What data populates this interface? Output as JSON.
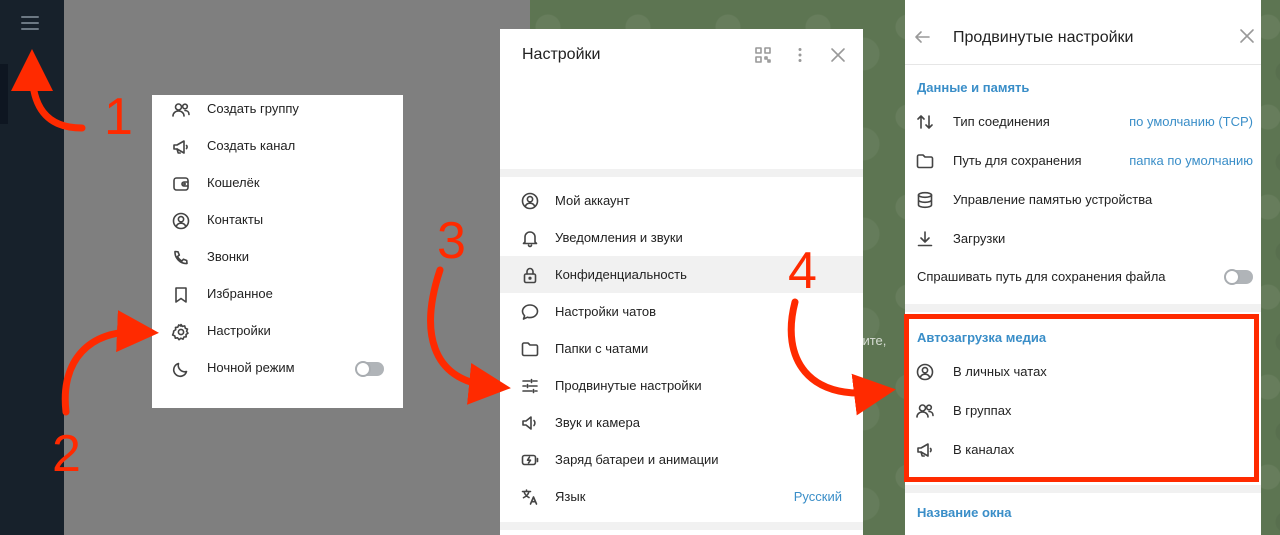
{
  "colors": {
    "accent": "#3a8ec8",
    "annotation": "#ff2a00",
    "sidebar": "#17212b"
  },
  "menu": {
    "items": [
      {
        "label": "Создать группу",
        "icon": "group-icon"
      },
      {
        "label": "Создать канал",
        "icon": "megaphone-icon"
      },
      {
        "label": "Кошелёк",
        "icon": "wallet-icon"
      },
      {
        "label": "Контакты",
        "icon": "contact-icon"
      },
      {
        "label": "Звонки",
        "icon": "phone-icon"
      },
      {
        "label": "Избранное",
        "icon": "bookmark-icon"
      },
      {
        "label": "Настройки",
        "icon": "gear-icon"
      },
      {
        "label": "Ночной режим",
        "icon": "moon-icon"
      }
    ],
    "night_mode_on": false
  },
  "settings": {
    "title": "Настройки",
    "items": [
      {
        "label": "Мой аккаунт",
        "icon": "account-icon"
      },
      {
        "label": "Уведомления и звуки",
        "icon": "bell-icon"
      },
      {
        "label": "Конфиденциальность",
        "icon": "lock-icon"
      },
      {
        "label": "Настройки чатов",
        "icon": "chat-bubble-icon"
      },
      {
        "label": "Папки с чатами",
        "icon": "folder-icon"
      },
      {
        "label": "Продвинутые настройки",
        "icon": "sliders-icon"
      },
      {
        "label": "Звук и камера",
        "icon": "speaker-icon"
      },
      {
        "label": "Заряд батареи и анимации",
        "icon": "battery-icon"
      },
      {
        "label": "Язык",
        "icon": "translate-icon",
        "value": "Русский"
      }
    ],
    "highlighted_item": "Конфиденциальность"
  },
  "advanced": {
    "title": "Продвинутые настройки",
    "data_section": "Данные и память",
    "items": [
      {
        "label": "Тип соединения",
        "icon": "arrows-updown-icon",
        "value": "по умолчанию (TCP)"
      },
      {
        "label": "Путь для сохранения",
        "icon": "folder-icon",
        "value": "папка по умолчанию"
      },
      {
        "label": "Управление памятью устройства",
        "icon": "database-icon"
      },
      {
        "label": "Загрузки",
        "icon": "download-icon"
      }
    ],
    "ask_path_label": "Спрашивать путь для сохранения файла",
    "ask_path_on": false,
    "autoload_section": "Автозагрузка медиа",
    "autoload_items": [
      {
        "label": "В личных чатах",
        "icon": "account-icon"
      },
      {
        "label": "В группах",
        "icon": "group-icon"
      },
      {
        "label": "В каналах",
        "icon": "megaphone-icon"
      }
    ],
    "window_section": "Название окна"
  },
  "background_peek": "ерите,",
  "annotations": [
    "1",
    "2",
    "3",
    "4"
  ]
}
